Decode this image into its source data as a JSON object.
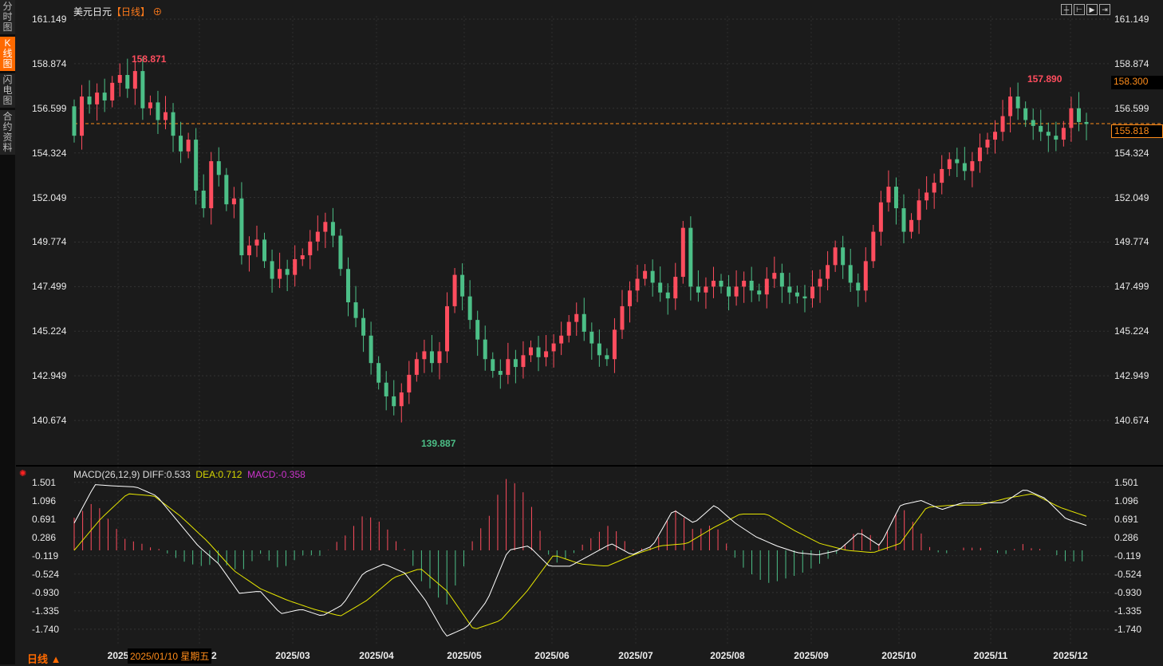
{
  "sidebar": {
    "tabs": [
      "分时图",
      "K线图",
      "闪电图",
      "合约资料"
    ],
    "active": 1
  },
  "header": {
    "instrument": "美元日元",
    "period_tag": "【日线】",
    "add_icon": "circle-plus-icon"
  },
  "toolbar": {
    "icons": [
      "crosshair-icon",
      "range-select-icon",
      "play-forward-icon",
      "scroll-end-icon"
    ]
  },
  "price_axis": {
    "ticks": [
      "161.149",
      "158.874",
      "156.599",
      "154.324",
      "152.049",
      "149.774",
      "147.499",
      "145.224",
      "142.949",
      "140.674"
    ],
    "current_price": "155.818",
    "marker_price": "158.300"
  },
  "macd_axis": {
    "ticks": [
      "1.501",
      "1.096",
      "0.691",
      "0.286",
      "-0.119",
      "-0.524",
      "-0.930",
      "-1.335",
      "-1.740"
    ]
  },
  "macd_header": {
    "label": "MACD(26,12,9)",
    "diff": "DIFF:0.533",
    "dea": "DEA:0.712",
    "macd": "MACD:-0.358"
  },
  "x_axis": {
    "labels": [
      "2025",
      "2025/02",
      "2025/03",
      "2025/04",
      "2025/05",
      "2025/06",
      "2025/07",
      "2025/08",
      "2025/09",
      "2025/10",
      "2025/11",
      "2025/12"
    ]
  },
  "tooltip": "2025/01/10 星期五",
  "period_button": "日线 ▲",
  "colors": {
    "up": "#ff4d5e",
    "down": "#4cbf87",
    "diff": "#ffffff",
    "dea": "#e6e600",
    "macd": "#cc33cc",
    "accent": "#ff6a00"
  },
  "chart_data": {
    "type": "candlestick",
    "ylim": [
      139.5,
      161.6
    ],
    "annotations": {
      "high": "158.871",
      "recent_high": "157.890",
      "low": "139.887"
    },
    "closes": [
      155.2,
      157.2,
      156.8,
      157.4,
      157.0,
      157.9,
      158.3,
      157.6,
      158.5,
      156.6,
      156.9,
      156.0,
      156.4,
      155.2,
      154.4,
      155.0,
      152.4,
      151.5,
      153.9,
      153.2,
      151.7,
      152.0,
      149.1,
      149.6,
      149.9,
      148.8,
      147.9,
      148.4,
      148.1,
      148.9,
      149.1,
      149.8,
      150.3,
      150.8,
      150.1,
      148.4,
      146.7,
      145.9,
      145.0,
      143.6,
      142.6,
      141.9,
      141.4,
      142.1,
      143.0,
      143.8,
      144.2,
      143.6,
      144.2,
      146.5,
      148.1,
      147.0,
      145.8,
      144.8,
      143.8,
      143.2,
      143.0,
      143.8,
      143.4,
      144.0,
      144.4,
      143.9,
      144.2,
      144.6,
      145.0,
      145.7,
      146.1,
      145.2,
      144.6,
      144.0,
      143.8,
      145.3,
      146.5,
      147.3,
      147.9,
      148.3,
      147.7,
      147.2,
      146.9,
      148.0,
      150.5,
      147.5,
      147.2,
      147.5,
      147.8,
      147.5,
      147.0,
      147.5,
      147.8,
      147.3,
      147.1,
      147.9,
      148.2,
      147.5,
      147.2,
      147.0,
      146.9,
      147.5,
      147.9,
      148.6,
      149.5,
      148.6,
      147.7,
      147.3,
      148.8,
      150.3,
      151.8,
      152.6,
      151.5,
      150.3,
      150.9,
      151.9,
      152.3,
      152.8,
      153.5,
      154.0,
      153.8,
      153.4,
      153.9,
      154.6,
      155.0,
      155.4,
      156.2,
      157.2,
      156.6,
      156.0,
      155.7,
      155.4,
      155.2,
      155.0,
      155.6,
      156.6,
      155.9,
      155.8
    ],
    "macd": {
      "diff": [
        0.6,
        1.45,
        1.42,
        1.4,
        1.2,
        0.65,
        0.1,
        -0.3,
        -0.95,
        -0.9,
        -1.4,
        -1.3,
        -1.45,
        -1.2,
        -0.5,
        -0.3,
        -0.5,
        -1.1,
        -1.9,
        -1.7,
        -1.1,
        0.0,
        0.1,
        -0.35,
        -0.35,
        -0.1,
        0.15,
        -0.1,
        0.1,
        0.9,
        0.6,
        1.0,
        0.6,
        0.3,
        0.1,
        -0.05,
        -0.1,
        0.0,
        0.4,
        0.1,
        1.0,
        1.1,
        0.9,
        1.05,
        1.05,
        1.05,
        1.35,
        1.15,
        0.7,
        0.55
      ],
      "dea": [
        0.0,
        0.7,
        1.25,
        1.2,
        0.75,
        0.2,
        -0.45,
        -0.85,
        -1.1,
        -1.3,
        -1.45,
        -1.1,
        -0.6,
        -0.4,
        -0.9,
        -1.75,
        -1.55,
        -0.9,
        -0.1,
        -0.3,
        -0.35,
        -0.1,
        0.1,
        0.15,
        0.5,
        0.8,
        0.8,
        0.45,
        0.15,
        0.0,
        -0.05,
        0.15,
        0.95,
        1.0,
        1.0,
        1.15,
        1.25,
        0.95,
        0.75
      ],
      "ylim": [
        -1.9,
        1.6
      ]
    }
  }
}
